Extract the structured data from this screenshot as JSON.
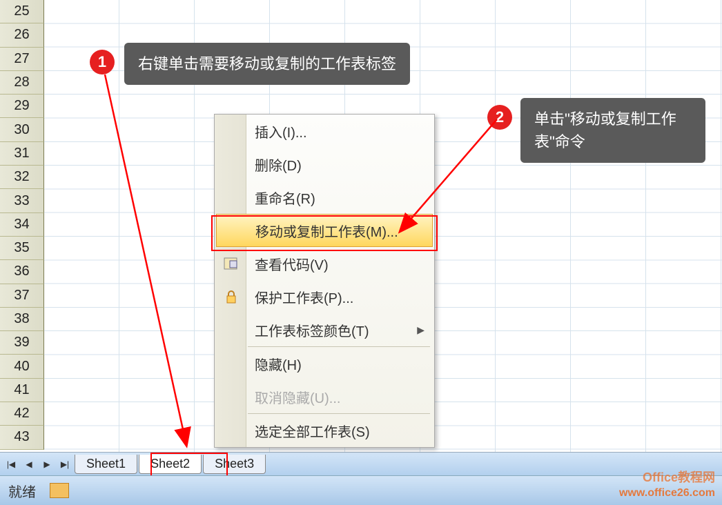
{
  "rows": [
    "25",
    "26",
    "27",
    "28",
    "29",
    "30",
    "31",
    "32",
    "33",
    "34",
    "35",
    "36",
    "37",
    "38",
    "39",
    "40",
    "41",
    "42",
    "43"
  ],
  "tabs": {
    "sheet1": "Sheet1",
    "sheet2": "Sheet2",
    "sheet3": "Sheet3"
  },
  "status": {
    "ready": "就绪"
  },
  "menu": {
    "insert": "插入(I)...",
    "delete": "删除(D)",
    "rename": "重命名(R)",
    "move_copy": "移动或复制工作表(M)...",
    "view_code": "查看代码(V)",
    "protect": "保护工作表(P)...",
    "tab_color": "工作表标签颜色(T)",
    "hide": "隐藏(H)",
    "unhide": "取消隐藏(U)...",
    "select_all": "选定全部工作表(S)"
  },
  "callouts": {
    "badge1": "1",
    "text1": "右键单击需要移动或复制的工作表标签",
    "badge2": "2",
    "text2": "单击\"移动或复制工作表\"命令"
  },
  "watermark": {
    "top": "Office教程网",
    "url": "www.office26.com"
  }
}
